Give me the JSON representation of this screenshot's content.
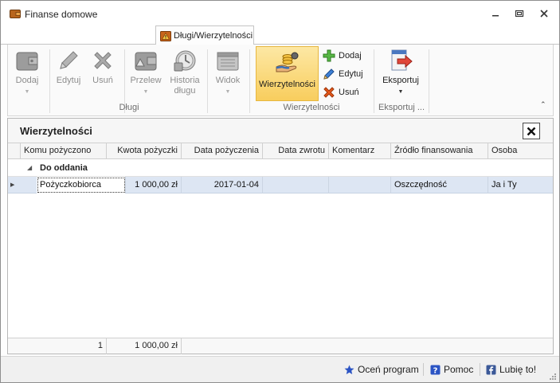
{
  "window": {
    "title": "Finanse domowe"
  },
  "ribbon": {
    "tab_label": "Długi/Wierzytelności",
    "groups": {
      "dlugi": {
        "label": "Długi",
        "dodaj": "Dodaj",
        "edytuj": "Edytuj",
        "usun": "Usuń",
        "przelew": "Przelew",
        "historia_line1": "Historia",
        "historia_line2": "długu",
        "widok": "Widok"
      },
      "wierzytelnosci": {
        "label": "Wierzytelności",
        "main": "Wierzytelności",
        "dodaj": "Dodaj",
        "edytuj": "Edytuj",
        "usun": "Usuń"
      },
      "eksport": {
        "label": "Eksportuj ...",
        "button": "Eksportuj"
      }
    }
  },
  "panel": {
    "title": "Wierzytelności",
    "columns": [
      "Komu pożyczono",
      "Kwota pożyczki",
      "Data pożyczenia",
      "Data zwrotu",
      "Komentarz",
      "Źródło finansowania",
      "Osoba"
    ],
    "group_label": "Do oddania",
    "rows": [
      {
        "komu": "Pożyczkobiorca",
        "kwota": "1 000,00 zł",
        "data_pozyczenia": "2017-01-04",
        "data_zwrotu": "",
        "komentarz": "",
        "zrodlo": "Oszczędność",
        "osoba": "Ja i Ty"
      }
    ],
    "footer": {
      "count": "1",
      "sum": "1 000,00 zł"
    }
  },
  "statusbar": {
    "rate": "Oceń program",
    "help": "Pomoc",
    "like": "Lubię to!"
  },
  "colors": {
    "active_button": "#f8cd5d",
    "selected_row": "#dde6f3",
    "disabled_text": "#8d8d8d"
  }
}
